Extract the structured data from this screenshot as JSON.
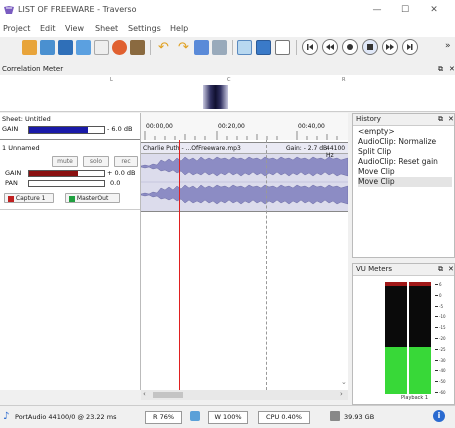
{
  "window": {
    "title": "LIST OF FREEWARE - Traverso",
    "min": "—",
    "max": "☐",
    "close": "✕"
  },
  "menu": [
    "Project",
    "Edit",
    "View",
    "Sheet",
    "Settings",
    "Help"
  ],
  "correlation": {
    "title": "Correlation Meter",
    "left": "L",
    "center": "C",
    "right": "R"
  },
  "sheet": {
    "name": "Sheet: Untitled",
    "gain_label": "GAIN",
    "gain_value": "- 6.0 dB",
    "gain_fraction": 0.78
  },
  "track": {
    "name": "1  Unnamed",
    "mute": "mute",
    "solo": "solo",
    "rec": "rec",
    "gain_label": "GAIN",
    "gain_value": "+ 0.0 dB",
    "gain_fraction": 0.65,
    "pan_label": "PAN",
    "pan_value": "0.0",
    "capture": "Capture 1",
    "masterout": "MasterOut"
  },
  "ruler": {
    "t0": "00:00,00",
    "t1": "00:20,00",
    "t2": "00:40,00"
  },
  "clip": {
    "name": "Charlie Puth - ...OfFreeware.mp3",
    "gain": "Gain: - 2.7 dB",
    "rate": "44100 Hz"
  },
  "history": {
    "title": "History",
    "items": [
      "<empty>",
      "AudioClip: Normalize",
      "Split Clip",
      "AudioClip: Reset gain",
      "Move Clip",
      "Move Clip"
    ]
  },
  "vu": {
    "title": "VU Meters",
    "scale": [
      "6",
      "0",
      "-5",
      "-10",
      "-15",
      "-20",
      "-25",
      "-30",
      "-40",
      "-50",
      "-60"
    ],
    "left_level": 0.42,
    "right_level": 0.42,
    "label": "Playback 1"
  },
  "status": {
    "audio": "PortAudio  44100/0 @ 23.22 ms",
    "read": "R 76%",
    "write": "W 100%",
    "cpu": "CPU 0.40%",
    "disk": "39.93 GB"
  },
  "colors": {
    "accent": "#1e82d2",
    "playhead": "#e02020",
    "waveform": "#9090c8"
  }
}
